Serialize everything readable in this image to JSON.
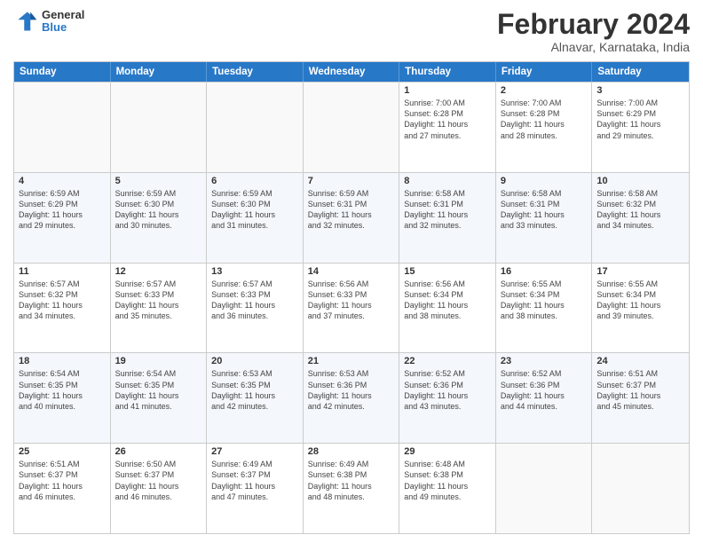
{
  "header": {
    "logo_general": "General",
    "logo_blue": "Blue",
    "month_title": "February 2024",
    "location": "Alnavar, Karnataka, India"
  },
  "weekdays": [
    "Sunday",
    "Monday",
    "Tuesday",
    "Wednesday",
    "Thursday",
    "Friday",
    "Saturday"
  ],
  "weeks": [
    [
      {
        "day": "",
        "info": ""
      },
      {
        "day": "",
        "info": ""
      },
      {
        "day": "",
        "info": ""
      },
      {
        "day": "",
        "info": ""
      },
      {
        "day": "1",
        "info": "Sunrise: 7:00 AM\nSunset: 6:28 PM\nDaylight: 11 hours\nand 27 minutes."
      },
      {
        "day": "2",
        "info": "Sunrise: 7:00 AM\nSunset: 6:28 PM\nDaylight: 11 hours\nand 28 minutes."
      },
      {
        "day": "3",
        "info": "Sunrise: 7:00 AM\nSunset: 6:29 PM\nDaylight: 11 hours\nand 29 minutes."
      }
    ],
    [
      {
        "day": "4",
        "info": "Sunrise: 6:59 AM\nSunset: 6:29 PM\nDaylight: 11 hours\nand 29 minutes."
      },
      {
        "day": "5",
        "info": "Sunrise: 6:59 AM\nSunset: 6:30 PM\nDaylight: 11 hours\nand 30 minutes."
      },
      {
        "day": "6",
        "info": "Sunrise: 6:59 AM\nSunset: 6:30 PM\nDaylight: 11 hours\nand 31 minutes."
      },
      {
        "day": "7",
        "info": "Sunrise: 6:59 AM\nSunset: 6:31 PM\nDaylight: 11 hours\nand 32 minutes."
      },
      {
        "day": "8",
        "info": "Sunrise: 6:58 AM\nSunset: 6:31 PM\nDaylight: 11 hours\nand 32 minutes."
      },
      {
        "day": "9",
        "info": "Sunrise: 6:58 AM\nSunset: 6:31 PM\nDaylight: 11 hours\nand 33 minutes."
      },
      {
        "day": "10",
        "info": "Sunrise: 6:58 AM\nSunset: 6:32 PM\nDaylight: 11 hours\nand 34 minutes."
      }
    ],
    [
      {
        "day": "11",
        "info": "Sunrise: 6:57 AM\nSunset: 6:32 PM\nDaylight: 11 hours\nand 34 minutes."
      },
      {
        "day": "12",
        "info": "Sunrise: 6:57 AM\nSunset: 6:33 PM\nDaylight: 11 hours\nand 35 minutes."
      },
      {
        "day": "13",
        "info": "Sunrise: 6:57 AM\nSunset: 6:33 PM\nDaylight: 11 hours\nand 36 minutes."
      },
      {
        "day": "14",
        "info": "Sunrise: 6:56 AM\nSunset: 6:33 PM\nDaylight: 11 hours\nand 37 minutes."
      },
      {
        "day": "15",
        "info": "Sunrise: 6:56 AM\nSunset: 6:34 PM\nDaylight: 11 hours\nand 38 minutes."
      },
      {
        "day": "16",
        "info": "Sunrise: 6:55 AM\nSunset: 6:34 PM\nDaylight: 11 hours\nand 38 minutes."
      },
      {
        "day": "17",
        "info": "Sunrise: 6:55 AM\nSunset: 6:34 PM\nDaylight: 11 hours\nand 39 minutes."
      }
    ],
    [
      {
        "day": "18",
        "info": "Sunrise: 6:54 AM\nSunset: 6:35 PM\nDaylight: 11 hours\nand 40 minutes."
      },
      {
        "day": "19",
        "info": "Sunrise: 6:54 AM\nSunset: 6:35 PM\nDaylight: 11 hours\nand 41 minutes."
      },
      {
        "day": "20",
        "info": "Sunrise: 6:53 AM\nSunset: 6:35 PM\nDaylight: 11 hours\nand 42 minutes."
      },
      {
        "day": "21",
        "info": "Sunrise: 6:53 AM\nSunset: 6:36 PM\nDaylight: 11 hours\nand 42 minutes."
      },
      {
        "day": "22",
        "info": "Sunrise: 6:52 AM\nSunset: 6:36 PM\nDaylight: 11 hours\nand 43 minutes."
      },
      {
        "day": "23",
        "info": "Sunrise: 6:52 AM\nSunset: 6:36 PM\nDaylight: 11 hours\nand 44 minutes."
      },
      {
        "day": "24",
        "info": "Sunrise: 6:51 AM\nSunset: 6:37 PM\nDaylight: 11 hours\nand 45 minutes."
      }
    ],
    [
      {
        "day": "25",
        "info": "Sunrise: 6:51 AM\nSunset: 6:37 PM\nDaylight: 11 hours\nand 46 minutes."
      },
      {
        "day": "26",
        "info": "Sunrise: 6:50 AM\nSunset: 6:37 PM\nDaylight: 11 hours\nand 46 minutes."
      },
      {
        "day": "27",
        "info": "Sunrise: 6:49 AM\nSunset: 6:37 PM\nDaylight: 11 hours\nand 47 minutes."
      },
      {
        "day": "28",
        "info": "Sunrise: 6:49 AM\nSunset: 6:38 PM\nDaylight: 11 hours\nand 48 minutes."
      },
      {
        "day": "29",
        "info": "Sunrise: 6:48 AM\nSunset: 6:38 PM\nDaylight: 11 hours\nand 49 minutes."
      },
      {
        "day": "",
        "info": ""
      },
      {
        "day": "",
        "info": ""
      }
    ]
  ]
}
